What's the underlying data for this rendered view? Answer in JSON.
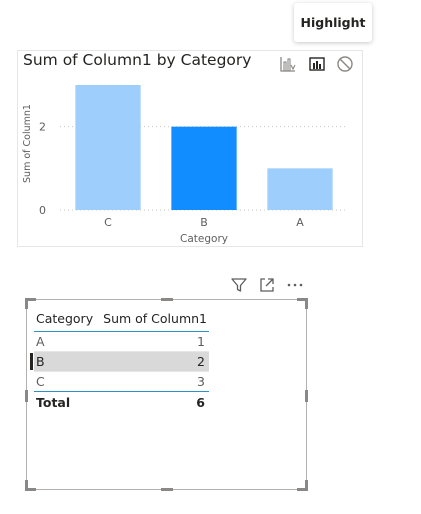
{
  "tooltip": {
    "text": "Highlight"
  },
  "bar_visual": {
    "icons": [
      "analytics-icon",
      "highlight-icon",
      "none-icon"
    ]
  },
  "chart_data": {
    "type": "bar",
    "title": "Sum of Column1 by Category",
    "xlabel": "Category",
    "ylabel": "Sum of Column1",
    "categories": [
      "C",
      "B",
      "A"
    ],
    "values": [
      3,
      2,
      1
    ],
    "highlighted_category": "B",
    "ylim": [
      0,
      3
    ],
    "yticks": [
      0,
      2
    ],
    "grid": true,
    "colors": {
      "normal": "#9ecffc",
      "highlighted": "#118dff"
    }
  },
  "table_toolbar": {
    "icons": [
      "filter-icon",
      "focus-mode-icon",
      "more-options-icon"
    ]
  },
  "table": {
    "headers": [
      "Category",
      "Sum of Column1"
    ],
    "rows": [
      {
        "category": "A",
        "value": "1"
      },
      {
        "category": "B",
        "value": "2"
      },
      {
        "category": "C",
        "value": "3"
      }
    ],
    "total_label": "Total",
    "total_value": "6",
    "selected_category": "B"
  }
}
